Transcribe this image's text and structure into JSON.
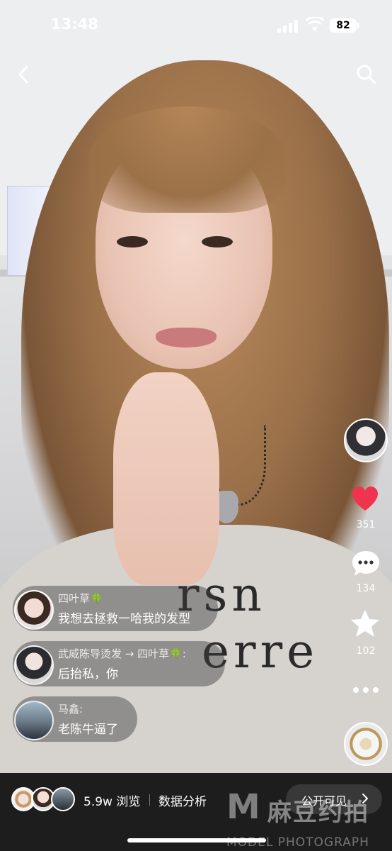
{
  "status_bar": {
    "time": "13:48",
    "battery": "82"
  },
  "rail": {
    "like_count": "351",
    "comment_count": "134",
    "favorite_count": "102"
  },
  "video": {
    "shirt_line1": "rsn",
    "shirt_line2": "erre"
  },
  "comments": [
    {
      "name": "四叶草🍀",
      "text": "我想去拯救一哈我的发型"
    },
    {
      "name": "武威陈导烫发 → 四叶草🍀:",
      "text": "后抬私，你"
    },
    {
      "name": "马鑫:",
      "text": "老陈牛逼了"
    }
  ],
  "bottom_bar": {
    "views": "5.9w 浏览",
    "analysis": "数据分析",
    "visibility": "公开可见"
  },
  "watermark": {
    "logo": "M",
    "cn": "麻豆约拍",
    "en": "MODEL PHOTOGRAPH"
  },
  "colors": {
    "like": "#f0344f",
    "bar_bg": "#1d1d1d"
  }
}
